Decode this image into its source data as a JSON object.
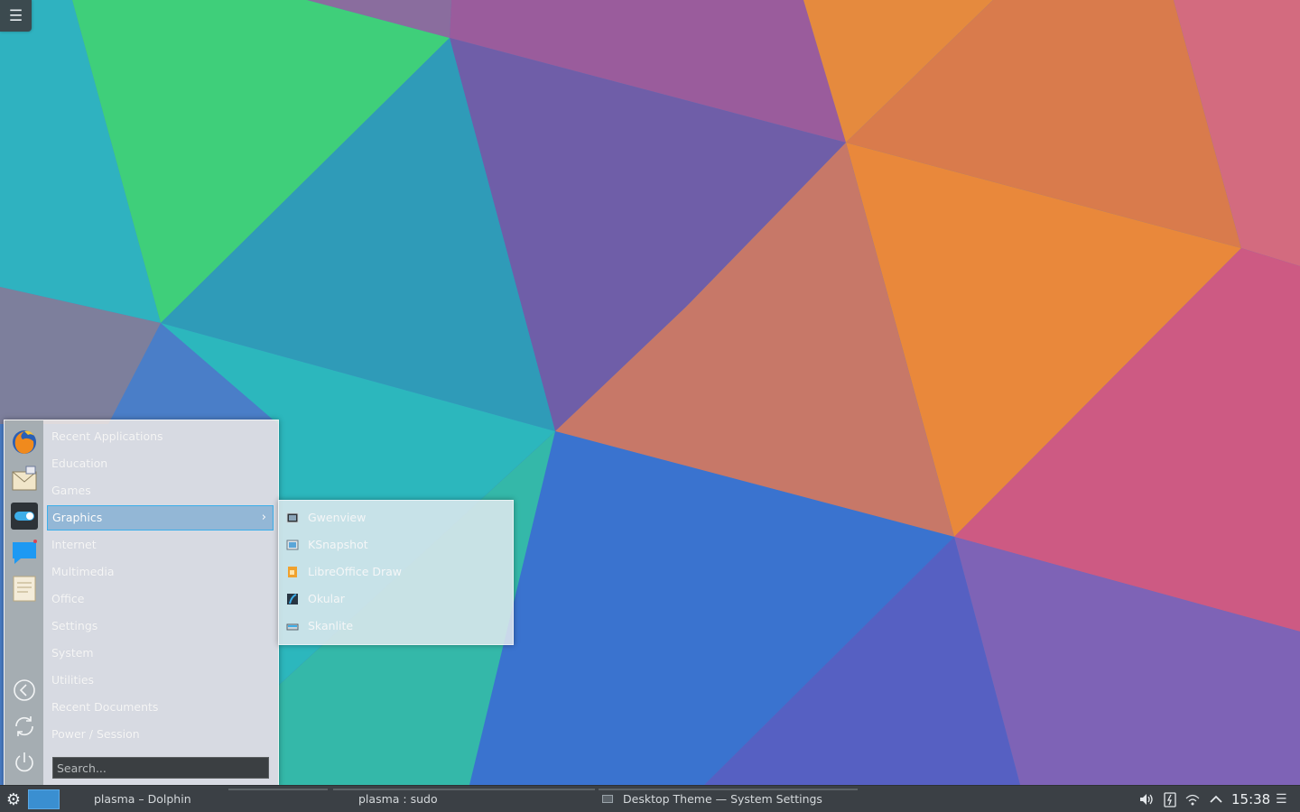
{
  "desktop": {
    "toolbox_icon": "hamburger-icon"
  },
  "launcher": {
    "favorites": [
      {
        "name": "firefox-icon"
      },
      {
        "name": "mail-icon"
      },
      {
        "name": "system-settings-icon"
      },
      {
        "name": "chat-icon"
      },
      {
        "name": "text-editor-icon"
      }
    ],
    "side_buttons": [
      "back-arrow-icon",
      "refresh-icon",
      "power-icon"
    ],
    "categories": [
      {
        "label": "Recent Applications"
      },
      {
        "label": "Education"
      },
      {
        "label": "Games"
      },
      {
        "label": "Graphics",
        "selected": true
      },
      {
        "label": "Internet"
      },
      {
        "label": "Multimedia"
      },
      {
        "label": "Office"
      },
      {
        "label": "Settings"
      },
      {
        "label": "System"
      },
      {
        "label": "Utilities"
      },
      {
        "label": "Recent Documents"
      },
      {
        "label": "Power / Session"
      }
    ],
    "selected_chevron": "›",
    "search_placeholder": "Search..."
  },
  "submenu": {
    "items": [
      {
        "label": "Gwenview",
        "icon": "gwenview-icon"
      },
      {
        "label": "KSnapshot",
        "icon": "ksnapshot-icon"
      },
      {
        "label": "LibreOffice Draw",
        "icon": "libreoffice-draw-icon"
      },
      {
        "label": "Okular",
        "icon": "okular-icon"
      },
      {
        "label": "Skanlite",
        "icon": "skanlite-icon"
      }
    ]
  },
  "taskbar": {
    "tasks": [
      {
        "label": "plasma – Dolphin"
      },
      {
        "label": "plasma : sudo"
      },
      {
        "label": "Desktop Theme — System Settings"
      }
    ],
    "clock": "15:38",
    "tray_icons": [
      "volume-icon",
      "battery-icon",
      "wifi-icon",
      "expand-tray-icon"
    ]
  },
  "colors": {
    "accent": "#3daee9",
    "panel": "#3b4045",
    "selection": "#93b7d6"
  }
}
